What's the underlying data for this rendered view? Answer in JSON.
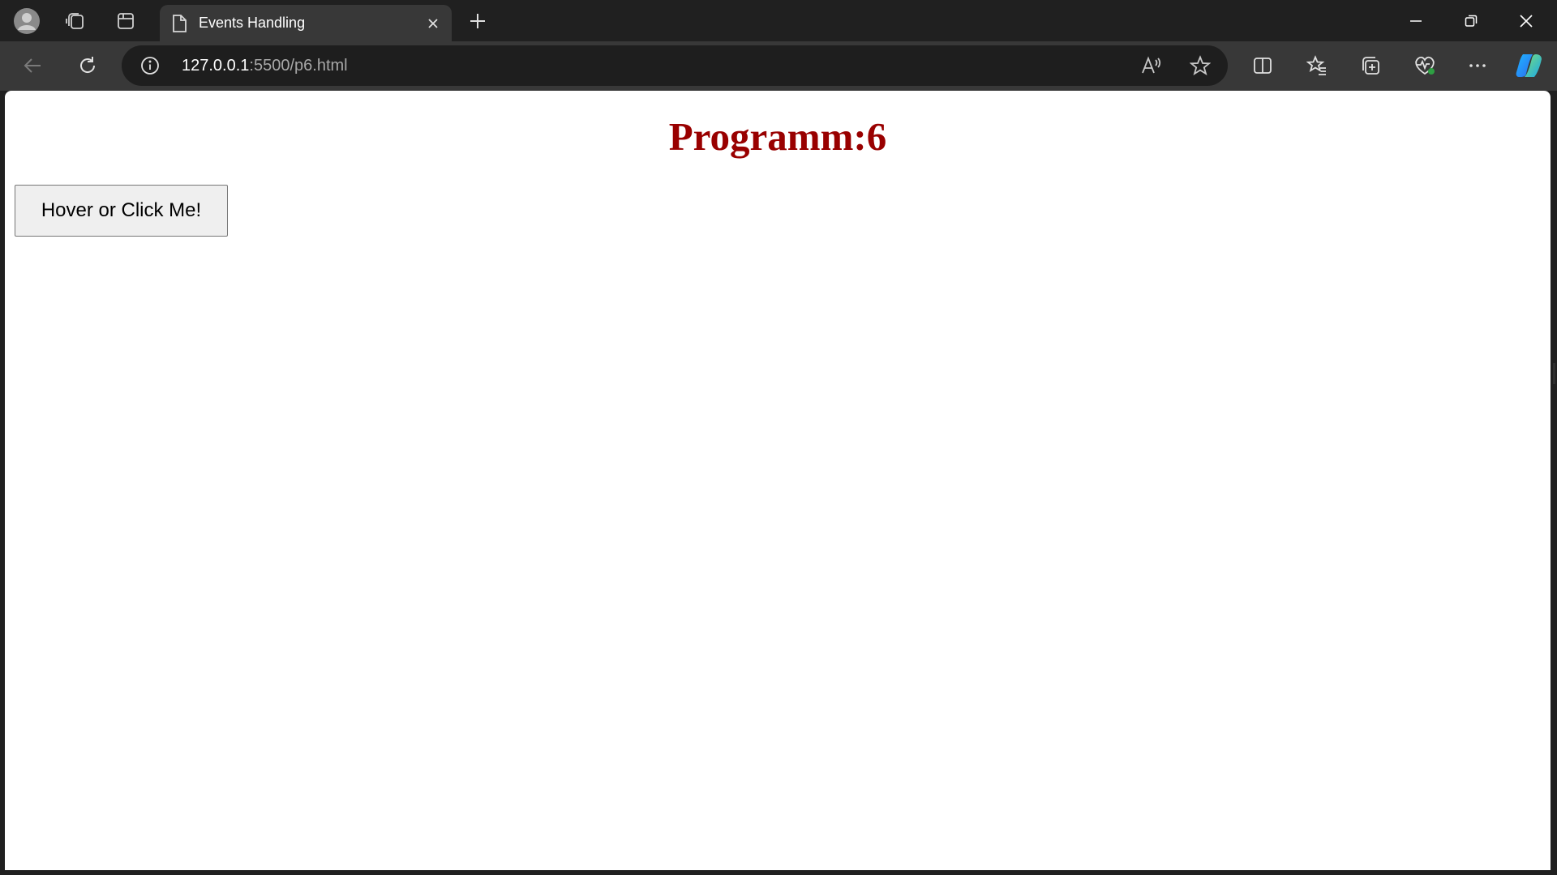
{
  "browser": {
    "tab": {
      "title": "Events Handling",
      "icon": "page-icon"
    },
    "address": {
      "host": "127.0.0.1",
      "rest": ":5500/p6.html"
    },
    "icons": {
      "profile": "profile-icon",
      "workspaces": "workspaces-icon",
      "tab_actions": "tab-actions-icon",
      "new_tab": "plus-icon",
      "back": "back-arrow-icon",
      "reload": "reload-icon",
      "site_info": "info-icon",
      "read_aloud": "read-aloud-icon",
      "favorite": "star-icon",
      "split_screen": "split-screen-icon",
      "favorites": "favorites-list-icon",
      "collections": "collections-icon",
      "browser_essentials": "heart-pulse-icon",
      "more": "ellipsis-icon",
      "copilot": "copilot-icon"
    },
    "colors": {
      "titlebar": "#202020",
      "toolbar": "#383838",
      "address_bar": "#1e1e1e"
    }
  },
  "page": {
    "heading": "Programm:6",
    "button_label": "Hover or Click Me!",
    "colors": {
      "heading": "#990000",
      "background": "#ffffff",
      "button_bg": "#efefef"
    }
  }
}
